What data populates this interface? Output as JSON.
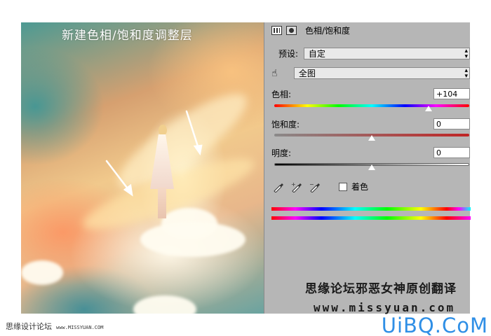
{
  "artwork": {
    "caption": "新建色相/饱和度调整层"
  },
  "panel": {
    "title": "色相/饱和度",
    "preset_label": "预设:",
    "preset_value": "自定",
    "channel_value": "全图",
    "hue": {
      "label": "色相:",
      "value": "+104",
      "level": 0.79
    },
    "saturation": {
      "label": "饱和度:",
      "value": "0",
      "level": 0.5
    },
    "lightness": {
      "label": "明度:",
      "value": "0",
      "level": 0.5
    },
    "colorize_label": "着色",
    "colorize_checked": false,
    "watermark_title": "思缘论坛邪恶女神原创翻译",
    "watermark_url": "www.missyuan.com"
  },
  "footer": {
    "site_name": "思缘设计论坛",
    "site_url": "www.MISSYUAN.COM",
    "brand": "UiBQ.CoM"
  },
  "colors": {
    "panel_bg": "#b6b6b6",
    "brand": "#2f8fe6",
    "arrow": "#ffffff"
  }
}
